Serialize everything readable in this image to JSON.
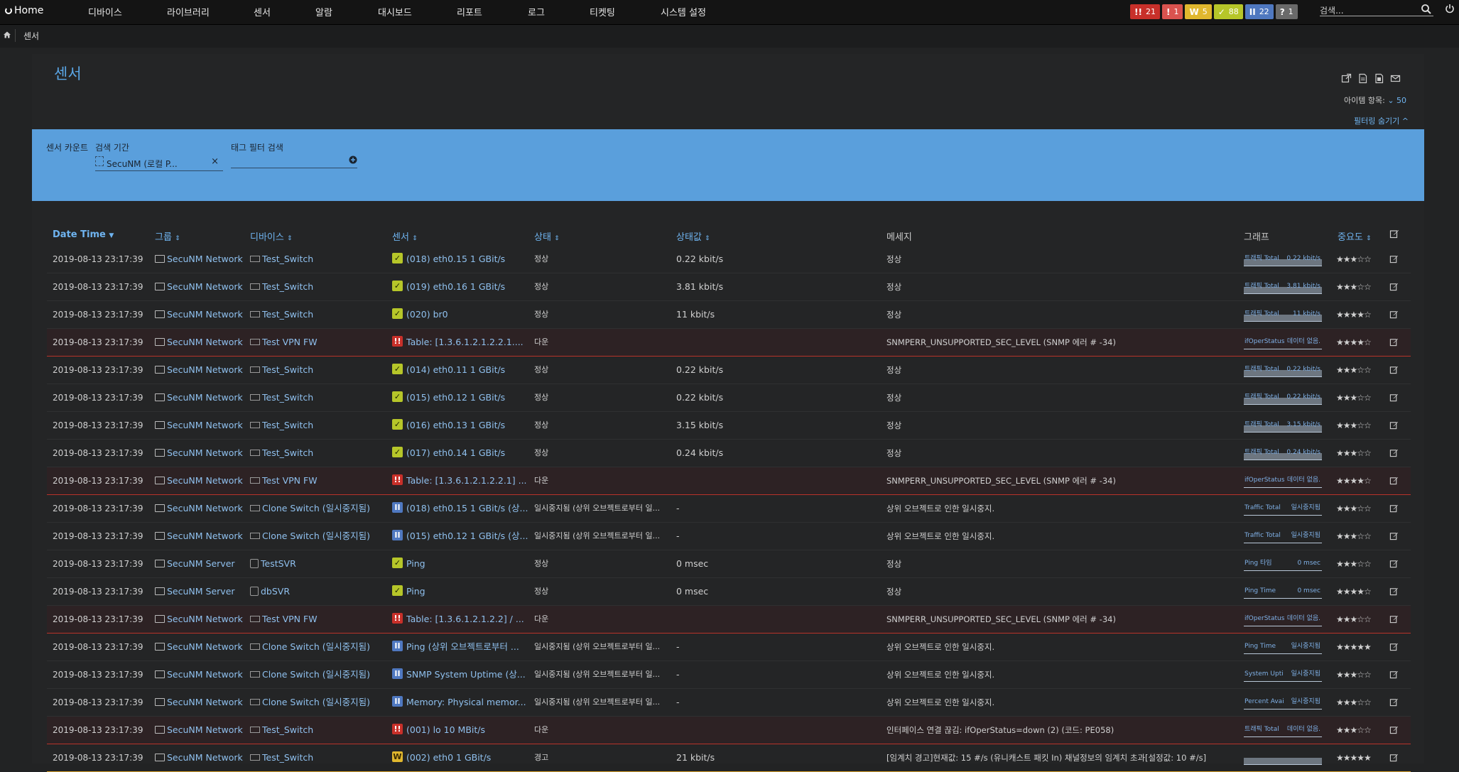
{
  "nav": {
    "home": "Home",
    "items": [
      "디바이스",
      "라이브러리",
      "센서",
      "알람",
      "대시보드",
      "리포트",
      "로그",
      "티켓팅",
      "시스템 설정"
    ],
    "badges": [
      {
        "icon": "!!",
        "count": "21",
        "color": "#c8302a"
      },
      {
        "icon": "!",
        "count": "1",
        "color": "#d9534f"
      },
      {
        "icon": "W",
        "count": "5",
        "color": "#e0b72e"
      },
      {
        "icon": "✓",
        "count": "88",
        "color": "#b6c629"
      },
      {
        "icon": "II",
        "count": "22",
        "color": "#4f78c0"
      },
      {
        "icon": "?",
        "count": "1",
        "color": "#6a6a6a"
      }
    ],
    "search_placeholder": "검색..."
  },
  "breadcrumb": {
    "current": "센서"
  },
  "page": {
    "title": "센서",
    "items_label": "아이템 항목:",
    "items_value": "50",
    "filter_toggle": "필터링 숨기기 ^"
  },
  "filter": {
    "sensor_count_label": "센서 카운트",
    "period_label": "검색 기간",
    "period_value": "SecuNM (로컬 P...",
    "period_clear": "×",
    "tag_label": "태그 필터 검색"
  },
  "table": {
    "headers": {
      "datetime": "Date Time",
      "group": "그룹",
      "device": "디바이스",
      "sensor": "센서",
      "status": "상태",
      "value": "상태값",
      "message": "메세지",
      "graph": "그래프",
      "priority": "중요도"
    },
    "rows": [
      {
        "date": "2019-08-13 23:17:39",
        "group": "SecuNM Network",
        "device": "Test_Switch",
        "devtype": "sw",
        "sensor": "(018) eth0.15 1 GBit/s",
        "stype": "ok",
        "status": "정상",
        "value": "0.22 kbit/s",
        "message": "정상",
        "glabel": "트래픽 Total",
        "gval": "0.22 kbit/s",
        "gfill": true,
        "stars": "★★★☆☆",
        "rowtype": "normal"
      },
      {
        "date": "2019-08-13 23:17:39",
        "group": "SecuNM Network",
        "device": "Test_Switch",
        "devtype": "sw",
        "sensor": "(019) eth0.16 1 GBit/s",
        "stype": "ok",
        "status": "정상",
        "value": "3.81 kbit/s",
        "message": "정상",
        "glabel": "트래픽 Total",
        "gval": "3.81 kbit/s",
        "gfill": true,
        "stars": "★★★☆☆",
        "rowtype": "normal"
      },
      {
        "date": "2019-08-13 23:17:39",
        "group": "SecuNM Network",
        "device": "Test_Switch",
        "devtype": "sw",
        "sensor": "(020) br0",
        "stype": "ok",
        "status": "정상",
        "value": "11 kbit/s",
        "message": "정상",
        "glabel": "트래픽 Total",
        "gval": "11 kbit/s",
        "gfill": true,
        "stars": "★★★★☆",
        "rowtype": "normal"
      },
      {
        "date": "2019-08-13 23:17:39",
        "group": "SecuNM Network",
        "device": "Test VPN FW",
        "devtype": "sw",
        "sensor": "Table: [1.3.6.1.2.1.2.2.1....",
        "stype": "down",
        "status": "다운",
        "value": "",
        "message": "SNMPERR_UNSUPPORTED_SEC_LEVEL (SNMP 에러 # -34)",
        "glabel": "ifOperStatus",
        "gval": "데이터 없음.",
        "gfill": false,
        "stars": "★★★★☆",
        "rowtype": "down"
      },
      {
        "date": "2019-08-13 23:17:39",
        "group": "SecuNM Network",
        "device": "Test_Switch",
        "devtype": "sw",
        "sensor": "(014) eth0.11 1 GBit/s",
        "stype": "ok",
        "status": "정상",
        "value": "0.22 kbit/s",
        "message": "정상",
        "glabel": "트래픽 Total",
        "gval": "0.22 kbit/s",
        "gfill": true,
        "stars": "★★★☆☆",
        "rowtype": "normal"
      },
      {
        "date": "2019-08-13 23:17:39",
        "group": "SecuNM Network",
        "device": "Test_Switch",
        "devtype": "sw",
        "sensor": "(015) eth0.12 1 GBit/s",
        "stype": "ok",
        "status": "정상",
        "value": "0.22 kbit/s",
        "message": "정상",
        "glabel": "트래픽 Total",
        "gval": "0.22 kbit/s",
        "gfill": true,
        "stars": "★★★☆☆",
        "rowtype": "normal"
      },
      {
        "date": "2019-08-13 23:17:39",
        "group": "SecuNM Network",
        "device": "Test_Switch",
        "devtype": "sw",
        "sensor": "(016) eth0.13 1 GBit/s",
        "stype": "ok",
        "status": "정상",
        "value": "3.15 kbit/s",
        "message": "정상",
        "glabel": "트래픽 Total",
        "gval": "3.15 kbit/s",
        "gfill": true,
        "stars": "★★★☆☆",
        "rowtype": "normal"
      },
      {
        "date": "2019-08-13 23:17:39",
        "group": "SecuNM Network",
        "device": "Test_Switch",
        "devtype": "sw",
        "sensor": "(017) eth0.14 1 GBit/s",
        "stype": "ok",
        "status": "정상",
        "value": "0.24 kbit/s",
        "message": "정상",
        "glabel": "트래픽 Total",
        "gval": "0.24 kbit/s",
        "gfill": true,
        "stars": "★★★☆☆",
        "rowtype": "normal"
      },
      {
        "date": "2019-08-13 23:17:39",
        "group": "SecuNM Network",
        "device": "Test VPN FW",
        "devtype": "sw",
        "sensor": "Table: [1.3.6.1.2.1.2.2.1] ...",
        "stype": "down",
        "status": "다운",
        "value": "",
        "message": "SNMPERR_UNSUPPORTED_SEC_LEVEL (SNMP 에러 # -34)",
        "glabel": "ifOperStatus",
        "gval": "데이터 없음.",
        "gfill": false,
        "stars": "★★★★☆",
        "rowtype": "down"
      },
      {
        "date": "2019-08-13 23:17:39",
        "group": "SecuNM Network",
        "device": "Clone Switch (일시중지됨)",
        "devtype": "sw",
        "sensor": "(018) eth0.15 1 GBit/s (상...",
        "stype": "pause",
        "status": "일시중지됨 (상위 오브젝트로부터 일...",
        "value": "-",
        "message": "상위 오브젝트로 인한 일시중지.",
        "glabel": "Traffic Total",
        "gval": "일시중지됨",
        "gfill": false,
        "stars": "★★★☆☆",
        "rowtype": "normal"
      },
      {
        "date": "2019-08-13 23:17:39",
        "group": "SecuNM Network",
        "device": "Clone Switch (일시중지됨)",
        "devtype": "sw",
        "sensor": "(015) eth0.12 1 GBit/s (상...",
        "stype": "pause",
        "status": "일시중지됨 (상위 오브젝트로부터 일...",
        "value": "-",
        "message": "상위 오브젝트로 인한 일시중지.",
        "glabel": "Traffic Total",
        "gval": "일시중지됨",
        "gfill": false,
        "stars": "★★★☆☆",
        "rowtype": "normal"
      },
      {
        "date": "2019-08-13 23:17:39",
        "group": "SecuNM Server",
        "device": "TestSVR",
        "devtype": "srv",
        "sensor": "Ping",
        "stype": "ok",
        "status": "정상",
        "value": "0 msec",
        "message": "정상",
        "glabel": "Ping 타임",
        "gval": "0 msec",
        "gfill": false,
        "stars": "★★★☆☆",
        "rowtype": "normal"
      },
      {
        "date": "2019-08-13 23:17:39",
        "group": "SecuNM Server",
        "device": "dbSVR",
        "devtype": "srv",
        "sensor": "Ping",
        "stype": "ok",
        "status": "정상",
        "value": "0 msec",
        "message": "정상",
        "glabel": "Ping Time",
        "gval": "0 msec",
        "gfill": false,
        "stars": "★★★★☆",
        "rowtype": "normal"
      },
      {
        "date": "2019-08-13 23:17:39",
        "group": "SecuNM Network",
        "device": "Test VPN FW",
        "devtype": "sw",
        "sensor": "Table: [1.3.6.1.2.1.2.2] / ...",
        "stype": "down",
        "status": "다운",
        "value": "",
        "message": "SNMPERR_UNSUPPORTED_SEC_LEVEL (SNMP 에러 # -34)",
        "glabel": "ifOperStatus",
        "gval": "데이터 없음.",
        "gfill": false,
        "stars": "★★★☆☆",
        "rowtype": "down"
      },
      {
        "date": "2019-08-13 23:17:39",
        "group": "SecuNM Network",
        "device": "Clone Switch (일시중지됨)",
        "devtype": "sw",
        "sensor": "Ping (상위 오브젝트로부터 ...",
        "stype": "pause",
        "status": "일시중지됨 (상위 오브젝트로부터 일...",
        "value": "-",
        "message": "상위 오브젝트로 인한 일시중지.",
        "glabel": "Ping Time",
        "gval": "일시중지됨",
        "gfill": false,
        "stars": "★★★★★",
        "rowtype": "normal"
      },
      {
        "date": "2019-08-13 23:17:39",
        "group": "SecuNM Network",
        "device": "Clone Switch (일시중지됨)",
        "devtype": "sw",
        "sensor": "SNMP System Uptime (상...",
        "stype": "pause",
        "status": "일시중지됨 (상위 오브젝트로부터 일...",
        "value": "-",
        "message": "상위 오브젝트로 인한 일시중지.",
        "glabel": "System Upti",
        "gval": "일시중지됨",
        "gfill": false,
        "stars": "★★★☆☆",
        "rowtype": "normal"
      },
      {
        "date": "2019-08-13 23:17:39",
        "group": "SecuNM Network",
        "device": "Clone Switch (일시중지됨)",
        "devtype": "sw",
        "sensor": "Memory: Physical memor...",
        "stype": "pause",
        "status": "일시중지됨 (상위 오브젝트로부터 일...",
        "value": "-",
        "message": "상위 오브젝트로 인한 일시중지.",
        "glabel": "Percent Avai",
        "gval": "일시중지됨",
        "gfill": false,
        "stars": "★★★☆☆",
        "rowtype": "normal"
      },
      {
        "date": "2019-08-13 23:17:39",
        "group": "SecuNM Network",
        "device": "Test_Switch",
        "devtype": "sw",
        "sensor": "(001) lo 10 MBit/s",
        "stype": "down",
        "status": "다운",
        "value": "",
        "message": "인터페이스 연결 끊김: ifOperStatus=down (2) (코드: PE058)",
        "glabel": "트래픽 Total",
        "gval": "데이터 없음.",
        "gfill": false,
        "stars": "★★★☆☆",
        "rowtype": "down"
      },
      {
        "date": "2019-08-13 23:17:39",
        "group": "SecuNM Network",
        "device": "Test_Switch",
        "devtype": "sw",
        "sensor": "(002) eth0 1 GBit/s",
        "stype": "warn",
        "status": "경고",
        "value": "21 kbit/s",
        "message": "[임계치 경고]현재값: 15 #/s (유니캐스트 패킷 In) 채널정보의 임계치 초과[설정값: 10 #/s]",
        "glabel": "",
        "gval": "",
        "gfill": true,
        "stars": "★★★★★",
        "rowtype": "warn"
      }
    ]
  }
}
